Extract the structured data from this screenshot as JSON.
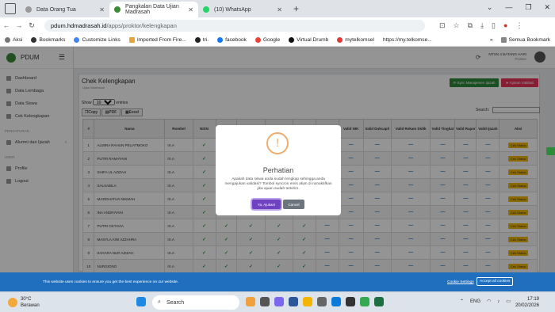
{
  "browser": {
    "tabs": [
      {
        "label": "Data Orang Tua",
        "active": false
      },
      {
        "label": "Pangkalan Data Ujian Madrasah",
        "active": true
      },
      {
        "label": "(10) WhatsApp",
        "active": false
      }
    ],
    "url_domain": "pdum.hdmadrasah.id",
    "url_path": "/apps/proktor/kelengkapan",
    "bookmarks": [
      "Aksi",
      "Bookmarks",
      "Customize Links",
      "Imported From Fire...",
      "tri.",
      "facebook",
      "Google",
      "Virtual Drumb",
      "mytelkomsel",
      "https://my.telkomse..."
    ],
    "bookmarks_right": "Semua Bookmark"
  },
  "app": {
    "brand": "PDUM",
    "school": "MTSN 4 BATANG HARI",
    "role": "Proktor",
    "menu": [
      {
        "label": "Dashboard",
        "section": ""
      },
      {
        "label": "Data Lembaga",
        "section": ""
      },
      {
        "label": "Data Siswa",
        "section": ""
      },
      {
        "label": "Cek Kelengkapan",
        "section": ""
      },
      {
        "label": "Alumni dan Ijazah",
        "section": "PENGATURAN"
      },
      {
        "label": "Profile",
        "section": "USER"
      },
      {
        "label": "Logout",
        "section": ""
      }
    ],
    "menu_sections": {
      "pengaturan": "PENGATURAN",
      "user": "USER"
    }
  },
  "page": {
    "title": "Chek Kelengkapan",
    "subtitle": "Ujian Madrasah",
    "sync_button": "Sync Manajemen Ijazah",
    "ajukan_button": "Ajukan Validasi",
    "show_label": "Show",
    "show_value": "10",
    "entries_label": "entries",
    "search_label": "Search:",
    "export_buttons": [
      "Copy",
      "PDF",
      "Excel"
    ],
    "columns": [
      "#",
      "Nama",
      "Rombel",
      "NISN",
      "No Akta",
      "Tempat Lahir",
      "Tanggal Lahir",
      "Sync NIS",
      "Valid NISN",
      "Valid NIK",
      "Valid Dukcapil",
      "Valid Rekam Didik",
      "Valid Tingkat",
      "Valid Rapor",
      "Valid Ijazah",
      "Aksi"
    ],
    "rows": [
      {
        "no": "1",
        "nama": "ALMIRA RAHUN PELIATMOKO",
        "rombel": "IX.A"
      },
      {
        "no": "2",
        "nama": "PUTRI RAMAYANI",
        "rombel": "IX.A"
      },
      {
        "no": "3",
        "nama": "SHIFA UL AZIZAH",
        "rombel": "IX.A"
      },
      {
        "no": "4",
        "nama": "SALSABILA",
        "rombel": "IX.A"
      },
      {
        "no": "5",
        "nama": "MAZIDHATUN NIKMAH",
        "rombel": "IX.A"
      },
      {
        "no": "6",
        "nama": "INA ANDRIYANI",
        "rombel": "IX.A"
      },
      {
        "no": "7",
        "nama": "PUTRI OKTAVIA",
        "rombel": "IX.A"
      },
      {
        "no": "8",
        "nama": "MASYLA AINI AZZAHRA",
        "rombel": "IX.A"
      },
      {
        "no": "9",
        "nama": "ZAHARA NUR AZIZAH",
        "rombel": "IX.A"
      },
      {
        "no": "10",
        "nama": "NURGIONO",
        "rombel": "IX.A"
      }
    ],
    "aksi_label": "Cek Status"
  },
  "modal": {
    "icon": "!",
    "title": "Perhatian",
    "message": "Apakah data siswa anda sudah lengkap sehingga anda mengajukan validasi? Tombol syncron emis akan di nonaktifkan jika ajuan sudah terkirim.",
    "confirm": "Ya, Ajukan!",
    "cancel": "Cancel"
  },
  "cookie": {
    "text": "This website uses cookies to ensure you get the best experience on our website.",
    "settings": "Cookie Settings",
    "accept": "Accept all cookies"
  },
  "taskbar": {
    "temp": "30°C",
    "weather": "Berawan",
    "search": "Search",
    "lang": "ENG",
    "time": "17:19",
    "date": "20/02/2026"
  },
  "colors": {
    "green": "#2e8b3a",
    "pink": "#e8345a",
    "modal_confirm": "#6f42c1",
    "cookie_bar": "#1f6fbe"
  }
}
